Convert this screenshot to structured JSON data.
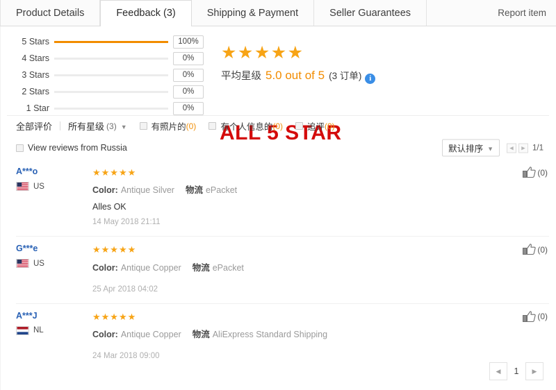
{
  "tabs": [
    {
      "label": "Product Details",
      "active": false
    },
    {
      "label": "Feedback (3)",
      "active": true
    },
    {
      "label": "Shipping & Payment",
      "active": false
    },
    {
      "label": "Seller Guarantees",
      "active": false
    }
  ],
  "report_item_label": "Report item",
  "rating_breakdown": [
    {
      "label": "5 Stars",
      "percent_label": "100%",
      "percent": 100
    },
    {
      "label": "4 Stars",
      "percent_label": "0%",
      "percent": 0
    },
    {
      "label": "3 Stars",
      "percent_label": "0%",
      "percent": 0
    },
    {
      "label": "2 Stars",
      "percent_label": "0%",
      "percent": 0
    },
    {
      "label": "1 Star",
      "percent_label": "0%",
      "percent": 0
    }
  ],
  "average": {
    "stars_glyphs": "★★★★★",
    "stars_count": 5,
    "label_cn": "平均星级",
    "score_text": "5.0 out of 5",
    "score_value": 5.0,
    "orders_text": "(3 订单)",
    "info_glyph": "i"
  },
  "banner_text": "ALL 5 STAR",
  "banner_color": "#d40b0b",
  "accent_color": "#f28c00",
  "filters": {
    "all_label": "全部评价",
    "star_select_label": "所有星级",
    "star_select_count": "(3)",
    "checkboxes": [
      {
        "label": "有照片的",
        "count": "(0)"
      },
      {
        "label": "有个人信息的",
        "count": "(0)"
      },
      {
        "label": "追评",
        "count": "(0)"
      }
    ]
  },
  "russia_filter_label": "View reviews from Russia",
  "sort": {
    "label": "默认排序"
  },
  "top_pager": {
    "page_text": "1/1",
    "prev_glyph": "◀",
    "next_glyph": "▶"
  },
  "reviews": [
    {
      "username": "A***o",
      "country_code": "US",
      "flag": "us",
      "stars_glyphs": "★★★★★",
      "stars_count": 5,
      "color_key": "Color:",
      "color_value": "Antique Silver",
      "ship_key": "物流",
      "ship_value": "ePacket",
      "text": "Alles OK",
      "date": "14 May 2018 21:11",
      "helpful_count": "(0)"
    },
    {
      "username": "G***e",
      "country_code": "US",
      "flag": "us",
      "stars_glyphs": "★★★★★",
      "stars_count": 5,
      "color_key": "Color:",
      "color_value": "Antique Copper",
      "ship_key": "物流",
      "ship_value": "ePacket",
      "text": "",
      "date": "25 Apr 2018 04:02",
      "helpful_count": "(0)"
    },
    {
      "username": "A***J",
      "country_code": "NL",
      "flag": "nl",
      "stars_glyphs": "★★★★★",
      "stars_count": 5,
      "color_key": "Color:",
      "color_value": "Antique Copper",
      "ship_key": "物流",
      "ship_value": "AliExpress Standard Shipping",
      "text": "",
      "date": "24 Mar 2018 09:00",
      "helpful_count": "(0)"
    }
  ],
  "bottom_pager": {
    "prev_glyph": "◀",
    "page_label": "1",
    "next_glyph": "▶"
  }
}
